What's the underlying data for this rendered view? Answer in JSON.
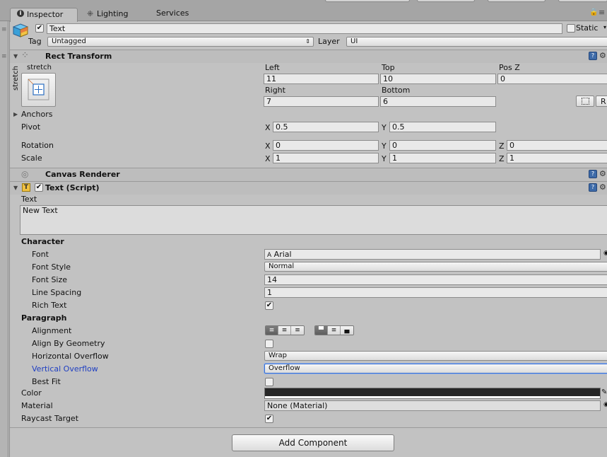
{
  "tabs": [
    {
      "label": "Inspector",
      "icon": "info-icon"
    },
    {
      "label": "Lighting",
      "icon": "lighting-icon"
    },
    {
      "label": "Services",
      "icon": ""
    }
  ],
  "header": {
    "object_name": "Text",
    "active": true,
    "static_label": "Static",
    "tag_label": "Tag",
    "tag_value": "Untagged",
    "layer_label": "Layer",
    "layer_value": "UI"
  },
  "rect_transform": {
    "title": "Rect Transform",
    "anchor_preset_top": "stretch",
    "anchor_preset_side": "stretch",
    "left_label": "Left",
    "left_value": "11",
    "top_label": "Top",
    "top_value": "10",
    "posz_label": "Pos Z",
    "posz_value": "0",
    "right_label": "Right",
    "right_value": "7",
    "bottom_label": "Bottom",
    "bottom_value": "6",
    "raw_button": "R",
    "anchors_label": "Anchors",
    "pivot_label": "Pivot",
    "pivot_x": "0.5",
    "pivot_y": "0.5",
    "rotation_label": "Rotation",
    "rot_x": "0",
    "rot_y": "0",
    "rot_z": "0",
    "scale_label": "Scale",
    "scale_x": "1",
    "scale_y": "1",
    "scale_z": "1",
    "axis_x": "X",
    "axis_y": "Y",
    "axis_z": "Z"
  },
  "canvas_renderer": {
    "title": "Canvas Renderer"
  },
  "text_script": {
    "title": "Text (Script)",
    "enabled": true,
    "text_label": "Text",
    "text_value": "New Text",
    "character_label": "Character",
    "font_label": "Font",
    "font_value": "Arial",
    "font_style_label": "Font Style",
    "font_style_value": "Normal",
    "font_size_label": "Font Size",
    "font_size_value": "14",
    "line_spacing_label": "Line Spacing",
    "line_spacing_value": "1",
    "rich_text_label": "Rich Text",
    "rich_text": true,
    "paragraph_label": "Paragraph",
    "alignment_label": "Alignment",
    "align_by_geometry_label": "Align By Geometry",
    "align_by_geometry": false,
    "h_overflow_label": "Horizontal Overflow",
    "h_overflow_value": "Wrap",
    "v_overflow_label": "Vertical Overflow",
    "v_overflow_value": "Overflow",
    "best_fit_label": "Best Fit",
    "best_fit": false,
    "color_label": "Color",
    "color_value": "#262626",
    "material_label": "Material",
    "material_value": "None (Material)",
    "raycast_label": "Raycast Target",
    "raycast": true
  },
  "add_component_label": "Add Component",
  "colors": {
    "panel": "#c2c2c2",
    "header": "#bdbdbd",
    "link_blue": "#1f3fc2"
  }
}
